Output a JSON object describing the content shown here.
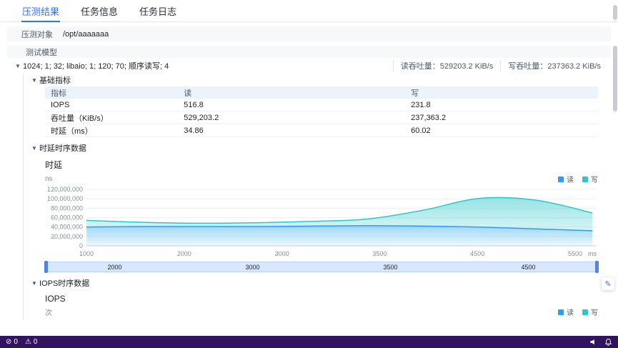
{
  "colors": {
    "accent": "#3370ff",
    "statusbar_bg": "#32135f",
    "read_series": "#2f9bff",
    "write_series": "#2ec7c9"
  },
  "icons": {
    "caret_down": "▼",
    "edit": "✎"
  },
  "icon_glyphs": {
    "error": "⊘",
    "warning": "⚠"
  },
  "tabs": [
    {
      "label": "压测结果",
      "active": true
    },
    {
      "label": "任务信息",
      "active": false
    },
    {
      "label": "任务日志",
      "active": false
    }
  ],
  "target": {
    "label": "压测对象",
    "value": "/opt/aaaaaaa"
  },
  "model": {
    "section_title": "测试模型",
    "row_label": "1024; 1; 32; libaio; 1; 120; 70; 顺序读写; 4",
    "read_throughput": "读吞吐量：529203.2 KiB/s",
    "write_throughput": "写吞吐量：237363.2 KiB/s"
  },
  "basic_metrics": {
    "title": "基础指标",
    "columns": [
      "指标",
      "读",
      "写"
    ],
    "rows": [
      [
        "IOPS",
        "516.8",
        "231.8"
      ],
      [
        "吞吐量（KiB/s）",
        "529,203.2",
        "237,363.2"
      ],
      [
        "时延（ms）",
        "34.86",
        "60.02"
      ]
    ]
  },
  "latency_section": {
    "title": "时延时序数据"
  },
  "iops_section": {
    "title": "IOPS时序数据"
  },
  "legend": [
    {
      "label": "读",
      "color": "#2f9bff"
    },
    {
      "label": "写",
      "color": "#2ec7c9"
    }
  ],
  "chart_data": [
    {
      "type": "area",
      "title": "时延",
      "ylabel": "ns",
      "xlabel": "ms",
      "x": [
        1000,
        1500,
        2000,
        2500,
        3000,
        3500,
        4000,
        4500,
        5000,
        5500
      ],
      "series": [
        {
          "name": "读",
          "color": "#2f9bff",
          "values": [
            40000000,
            41000000,
            41000000,
            41000000,
            42000000,
            43000000,
            42000000,
            40000000,
            36000000,
            32000000
          ]
        },
        {
          "name": "写",
          "color": "#2ec7c9",
          "values": [
            54000000,
            50000000,
            48000000,
            49000000,
            52000000,
            57000000,
            76000000,
            101000000,
            97000000,
            70000000
          ]
        }
      ],
      "ylim": [
        0,
        120000000
      ],
      "yticks": [
        "0",
        "20,000,000",
        "40,000,000",
        "60,000,000",
        "80,000,000",
        "100,000,000",
        "120,000,000"
      ],
      "xticks": [
        "1000",
        "2000",
        "3000",
        "3500",
        "4500",
        "5500"
      ],
      "slider_labels": [
        "2000",
        "3000",
        "3500",
        "4500"
      ],
      "legend_position": "top-right",
      "grid": true
    },
    {
      "type": "area",
      "title": "IOPS",
      "ylabel": "次",
      "legend": [
        "读",
        "写"
      ]
    }
  ],
  "status_bar": {
    "left": [
      {
        "icon": "error-circle",
        "count": "0"
      },
      {
        "icon": "warning",
        "count": "0"
      }
    ],
    "right": [
      "megaphone",
      "bell"
    ]
  }
}
